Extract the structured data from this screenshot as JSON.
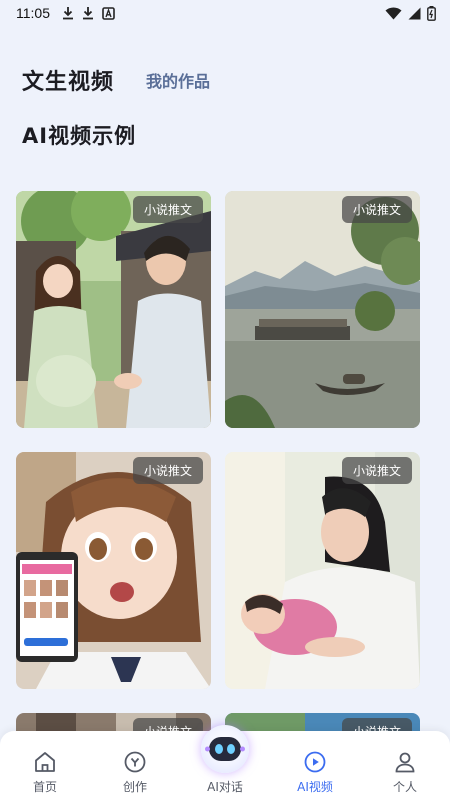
{
  "status_bar": {
    "time": "11:05",
    "icons_left": [
      "download-icon",
      "download-icon",
      "a-notification-icon"
    ],
    "icons_right": [
      "wifi-icon",
      "signal-icon",
      "battery-icon"
    ]
  },
  "header": {
    "title": "文生视频",
    "tab_label": "我的作品"
  },
  "section": {
    "title": "AI视频示例"
  },
  "cards": [
    {
      "tag": "小说推文",
      "scene": "couple-in-village"
    },
    {
      "tag": "小说推文",
      "scene": "lake-with-boats"
    },
    {
      "tag": "小说推文",
      "scene": "girl-holding-phone"
    },
    {
      "tag": "小说推文",
      "scene": "mother-with-baby"
    },
    {
      "tag": "小说推文",
      "scene": "partially-visible"
    },
    {
      "tag": "小说推文",
      "scene": "partially-visible"
    }
  ],
  "bottom_nav": {
    "items": [
      {
        "label": "首页",
        "icon": "home-icon"
      },
      {
        "label": "创作",
        "icon": "create-icon"
      },
      {
        "label": "AI对话",
        "icon": "robot-icon"
      },
      {
        "label": "AI视频",
        "icon": "video-play-icon",
        "active": true
      },
      {
        "label": "个人",
        "icon": "person-icon"
      }
    ]
  },
  "colors": {
    "background": "#eef2fb",
    "accent": "#3b6cf0",
    "tab_text": "#5a6f98"
  }
}
